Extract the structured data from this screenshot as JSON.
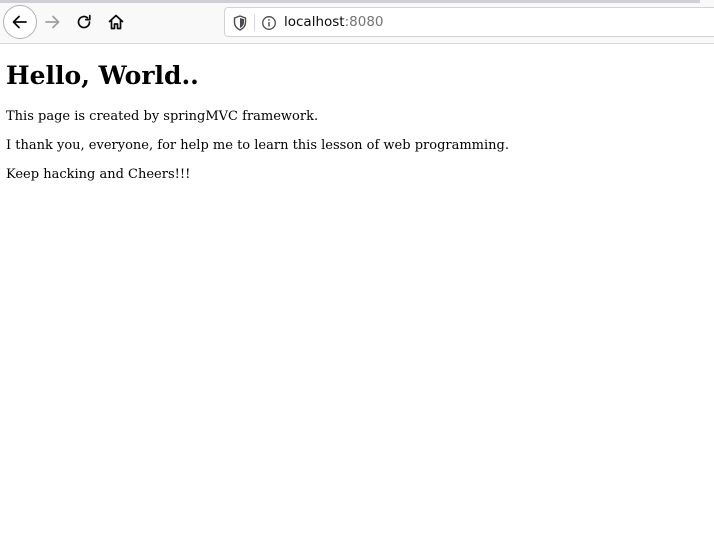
{
  "browser": {
    "url_host": "localhost",
    "url_port": ":8080",
    "icons": {
      "back": "arrow-left-icon",
      "forward": "arrow-right-icon",
      "reload": "reload-icon",
      "home": "home-icon",
      "tracking_protection": "shield-icon",
      "site_info": "info-icon"
    }
  },
  "page": {
    "heading": "Hello, World..",
    "paragraphs": [
      "This page is created by springMVC framework.",
      "I thank you, everyone, for help me to learn this lesson of web programming.",
      "Keep hacking and Cheers!!!"
    ]
  }
}
